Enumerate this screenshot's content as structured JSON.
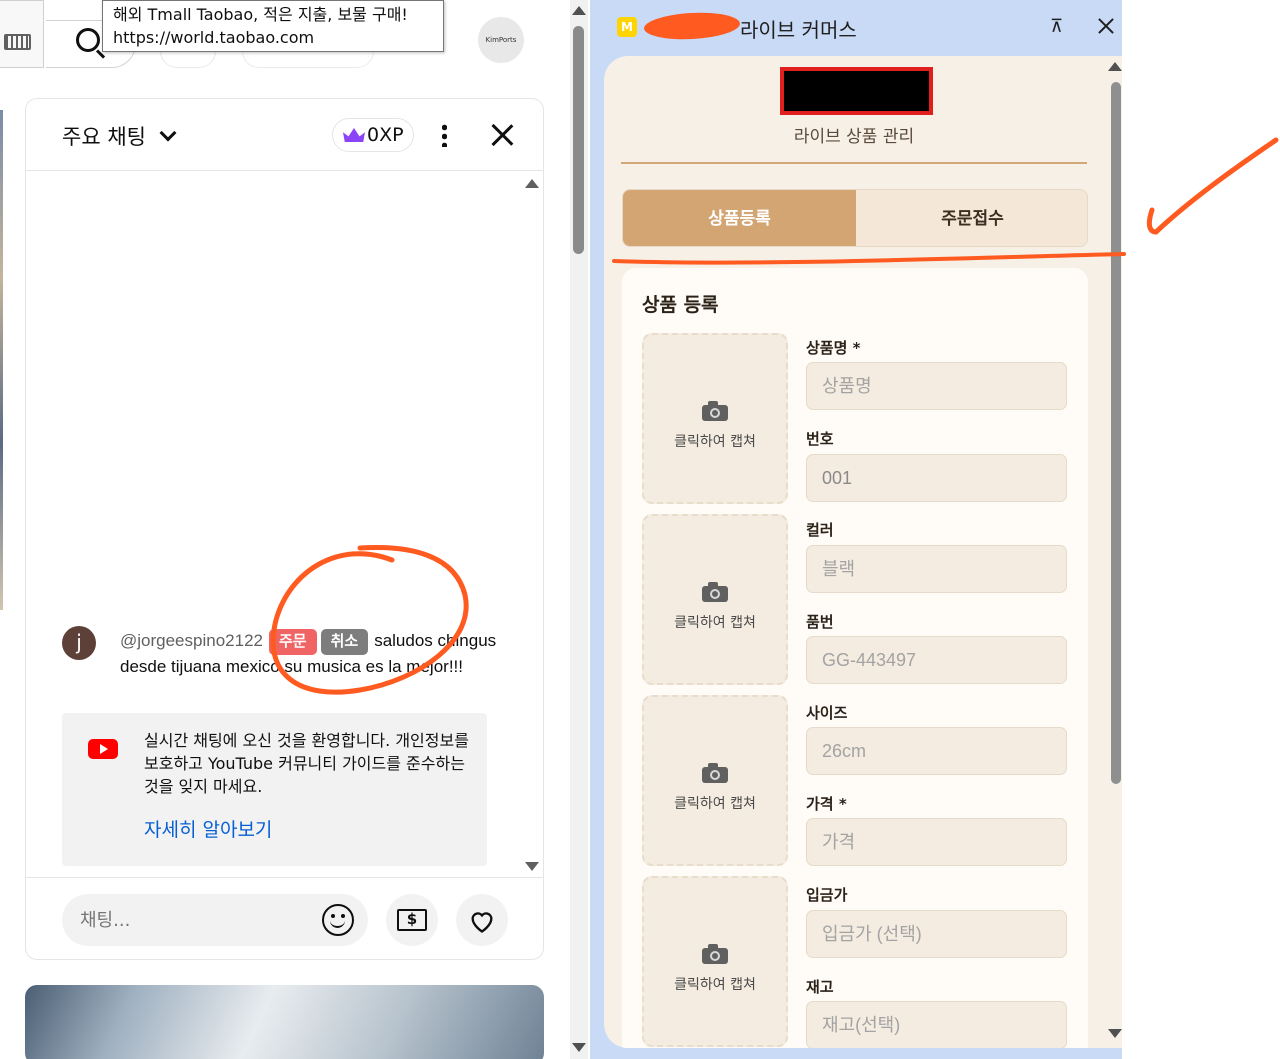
{
  "browser": {
    "tooltip": {
      "line1": "해외 Tmall Taobao, 적은 지출, 보물 구매!",
      "line2": "https://world.taobao.com"
    },
    "profile_label": "KimPorts"
  },
  "chat": {
    "title": "주요 채팅",
    "xp": "0XP",
    "message": {
      "avatar_letter": "j",
      "author": "@jorgeespino2122",
      "order_label": "주문",
      "cancel_label": "취소",
      "text_inline": "saludos",
      "text_rest": "chingus desde tijuana mexico su musica es la mejor!!!"
    },
    "notice": {
      "text": "실시간 채팅에 오신 것을 환영합니다. 개인정보를 보호하고 YouTube 커뮤니티 가이드를 준수하는 것을 잊지 마세요.",
      "link": "자세히 알아보기"
    },
    "input_placeholder": "채팅..."
  },
  "panel": {
    "app_icon_letter": "M",
    "title": "라이브 커머스",
    "pin_glyph": "⊼",
    "subtitle": "라이브 상품 관리",
    "tabs": [
      {
        "label": "상품등록",
        "active": true
      },
      {
        "label": "주문접수",
        "active": false
      }
    ],
    "form": {
      "title": "상품 등록",
      "capture_label": "클릭하여 캡쳐",
      "fields": [
        {
          "label": "상품명 *",
          "value": "",
          "placeholder": "상품명"
        },
        {
          "label": "번호",
          "value": "001",
          "placeholder": ""
        },
        {
          "label": "컬러",
          "value": "",
          "placeholder": "블랙"
        },
        {
          "label": "품번",
          "value": "",
          "placeholder": "GG-443497"
        },
        {
          "label": "사이즈",
          "value": "",
          "placeholder": "26cm"
        },
        {
          "label": "가격 *",
          "value": "",
          "placeholder": "가격"
        },
        {
          "label": "입금가",
          "value": "",
          "placeholder": "입금가 (선택)"
        },
        {
          "label": "재고",
          "value": "",
          "placeholder": "재고(선택)"
        }
      ]
    }
  },
  "colors": {
    "accent_tab": "#d3a573",
    "order_button": "#f16464",
    "cancel_button": "#7d7d7d",
    "annotation": "#ff5a1f",
    "panel_bg": "#f7f0e7",
    "link": "#065fd4"
  }
}
